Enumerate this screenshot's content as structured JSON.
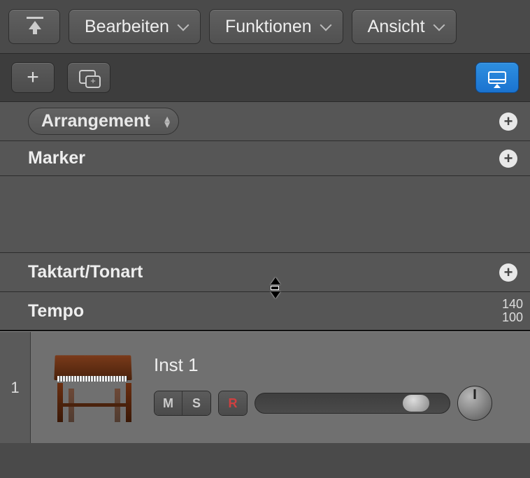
{
  "toolbar": {
    "edit_label": "Bearbeiten",
    "functions_label": "Funktionen",
    "view_label": "Ansicht"
  },
  "global_tracks": {
    "arrangement_label": "Arrangement",
    "marker_label": "Marker",
    "signature_label": "Taktart/Tonart",
    "tempo_label": "Tempo",
    "tempo_high": "140",
    "tempo_low": "100"
  },
  "track": {
    "number": "1",
    "name": "Inst 1",
    "mute": "M",
    "solo": "S",
    "record": "R"
  }
}
